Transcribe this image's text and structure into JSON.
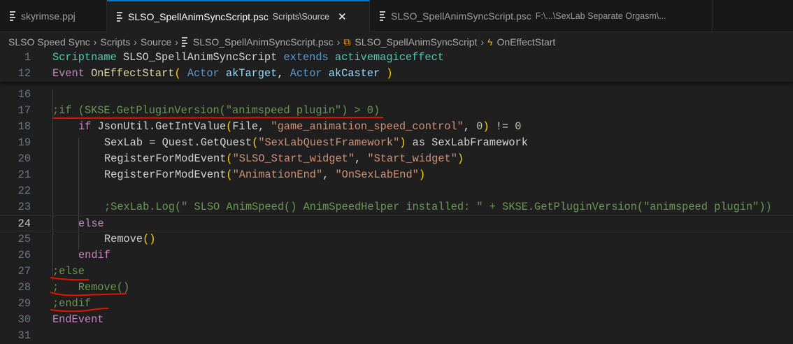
{
  "tabs": [
    {
      "label": "skyrimse.ppj",
      "desc": "",
      "active": false
    },
    {
      "label": "SLSO_SpellAnimSyncScript.psc",
      "desc": "Scripts\\Source",
      "active": true,
      "close": "✕"
    },
    {
      "label": "SLSO_SpellAnimSyncScript.psc",
      "desc": "F:\\...\\SexLab Separate Orgasm\\...",
      "active": false
    }
  ],
  "breadcrumb": [
    "SLSO Speed Sync",
    "Scripts",
    "Source",
    "SLSO_SpellAnimSyncScript.psc",
    "SLSO_SpellAnimSyncScript",
    "OnEffectStart"
  ],
  "breadcrumb_sep": "›",
  "colors": {
    "accent": "#0078d4",
    "underline": "#e51400"
  },
  "current_line": 24,
  "sticky_lines": [
    {
      "n": "1",
      "indent": 0,
      "tokens": [
        [
          "Scriptname",
          "cls"
        ],
        [
          " SLSO_SpellAnimSyncScript ",
          "id"
        ],
        [
          "extends",
          "type"
        ],
        [
          " ",
          "id"
        ],
        [
          "activemagiceffect",
          "cls"
        ]
      ]
    },
    {
      "n": "12",
      "indent": 0,
      "tokens": [
        [
          "Event",
          "kw"
        ],
        [
          " ",
          "id"
        ],
        [
          "OnEffectStart",
          "fn"
        ],
        [
          "(",
          "br"
        ],
        [
          " ",
          "id"
        ],
        [
          "Actor",
          "type"
        ],
        [
          " ",
          "id"
        ],
        [
          "akTarget",
          "var"
        ],
        [
          ", ",
          "id"
        ],
        [
          "Actor",
          "type"
        ],
        [
          " ",
          "id"
        ],
        [
          "akCaster",
          "var"
        ],
        [
          " ",
          "id"
        ],
        [
          ")",
          "br"
        ]
      ]
    }
  ],
  "lines": [
    {
      "n": "16",
      "indent": 0,
      "tokens": []
    },
    {
      "n": "17",
      "indent": 0,
      "tokens": [
        [
          ";if (SKSE.GetPluginVersion(\"animspeed plugin\") > 0)",
          "com"
        ]
      ]
    },
    {
      "n": "18",
      "indent": 1,
      "tokens": [
        [
          "if",
          "kw"
        ],
        [
          " JsonUtil.GetIntValue",
          "id"
        ],
        [
          "(",
          "br"
        ],
        [
          "File, ",
          "id"
        ],
        [
          "\"game_animation_speed_control\"",
          "str"
        ],
        [
          ", ",
          "id"
        ],
        [
          "0",
          "num"
        ],
        [
          ")",
          "br"
        ],
        [
          " != ",
          "id"
        ],
        [
          "0",
          "num"
        ]
      ]
    },
    {
      "n": "19",
      "indent": 2,
      "tokens": [
        [
          "SexLab = Quest.GetQuest",
          "id"
        ],
        [
          "(",
          "br"
        ],
        [
          "\"SexLabQuestFramework\"",
          "str"
        ],
        [
          ")",
          "br"
        ],
        [
          " as SexLabFramework",
          "id"
        ]
      ]
    },
    {
      "n": "20",
      "indent": 2,
      "tokens": [
        [
          "RegisterForModEvent",
          "id"
        ],
        [
          "(",
          "br"
        ],
        [
          "\"SLSO_Start_widget\"",
          "str"
        ],
        [
          ", ",
          "id"
        ],
        [
          "\"Start_widget\"",
          "str"
        ],
        [
          ")",
          "br"
        ]
      ]
    },
    {
      "n": "21",
      "indent": 2,
      "tokens": [
        [
          "RegisterForModEvent",
          "id"
        ],
        [
          "(",
          "br"
        ],
        [
          "\"AnimationEnd\"",
          "str"
        ],
        [
          ", ",
          "id"
        ],
        [
          "\"OnSexLabEnd\"",
          "str"
        ],
        [
          ")",
          "br"
        ]
      ]
    },
    {
      "n": "22",
      "indent": 2,
      "tokens": []
    },
    {
      "n": "23",
      "indent": 2,
      "tokens": [
        [
          ";SexLab.Log(\" SLSO AnimSpeed() AnimSpeedHelper installed: \" + SKSE.GetPluginVersion(\"animspeed plugin\"))",
          "com"
        ]
      ]
    },
    {
      "n": "24",
      "indent": 1,
      "tokens": [
        [
          "else",
          "kw"
        ]
      ]
    },
    {
      "n": "25",
      "indent": 2,
      "tokens": [
        [
          "Remove",
          "id"
        ],
        [
          "()",
          "br"
        ]
      ]
    },
    {
      "n": "26",
      "indent": 1,
      "tokens": [
        [
          "endif",
          "kw"
        ]
      ]
    },
    {
      "n": "27",
      "indent": 0,
      "tokens": [
        [
          ";else",
          "com"
        ]
      ]
    },
    {
      "n": "28",
      "indent": 0,
      "tokens": [
        [
          ";   Remove()",
          "com"
        ]
      ]
    },
    {
      "n": "29",
      "indent": 0,
      "tokens": [
        [
          ";endif",
          "com"
        ]
      ]
    },
    {
      "n": "30",
      "indent": 0,
      "tokens": [
        [
          "EndEvent",
          "kw"
        ]
      ]
    },
    {
      "n": "31",
      "indent": 0,
      "tokens": []
    }
  ]
}
